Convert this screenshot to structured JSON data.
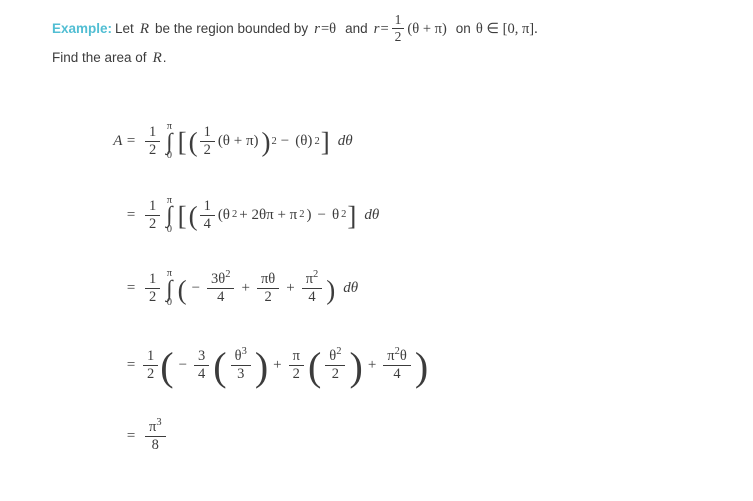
{
  "colors": {
    "accent": "#51bed3",
    "text": "#3c3c3c",
    "background": "#ffffff"
  },
  "prose": {
    "example_label": "Example:",
    "statement_pre": "Let",
    "statement_var_R": "R",
    "statement_mid1": "be the region bounded by",
    "eq1_var_r": "r",
    "eq1_equals": "=",
    "eq1_theta": "θ",
    "statement_and": "and",
    "eq2_var_r": "r",
    "eq2_equals": "=",
    "eq2_frac_num": "1",
    "eq2_frac_den": "2",
    "eq2_group": "(θ + π)",
    "statement_on": "on",
    "domain": "θ ∈ [0, π].",
    "question_pre": "Find the area of",
    "question_var_R": "R",
    "question_period": "."
  },
  "derivation": {
    "lines": [
      {
        "id": "line-1",
        "lhs": "A  =",
        "outer_frac_num": "1",
        "outer_frac_den": "2",
        "integral_upper": "π",
        "integral_lower": "0",
        "integral_symbol": "∫",
        "bracket_open": "[",
        "paren_open": "(",
        "inner_frac_num": "1",
        "inner_frac_den": "2",
        "inner_group": "(θ + π)",
        "paren_close": ")",
        "exp_outer": "2",
        "minus": "−",
        "term2": "(θ)",
        "term2_exp": "2",
        "bracket_close": "]",
        "differential": "dθ"
      },
      {
        "id": "line-2",
        "lhs": "=",
        "outer_frac_num": "1",
        "outer_frac_den": "2",
        "integral_upper": "π",
        "integral_lower": "0",
        "integral_symbol": "∫",
        "bracket_open": "[",
        "paren_open": "(",
        "inner_frac_num": "1",
        "inner_frac_den": "4",
        "expansion": "(θ",
        "expansion_exp1": "2",
        "expansion_mid": "+ 2θπ + π",
        "expansion_exp2": "2",
        "expansion_close": ")",
        "minus": "−",
        "term2": "θ",
        "term2_exp": "2",
        "bracket_close": "]",
        "differential": "dθ"
      },
      {
        "id": "line-3",
        "lhs": "=",
        "outer_frac_num": "1",
        "outer_frac_den": "2",
        "integral_upper": "π",
        "integral_lower": "0",
        "integral_symbol": "∫",
        "paren_open": "(",
        "minus": "−",
        "t1_num": "3θ",
        "t1_num_exp": "2",
        "t1_den": "4",
        "plus1": "+",
        "t2_num": "πθ",
        "t2_den": "2",
        "plus2": "+",
        "t3_num": "π",
        "t3_num_exp": "2",
        "t3_den": "4",
        "paren_close": ")",
        "differential": "dθ"
      },
      {
        "id": "line-4",
        "lhs": "=",
        "outer_frac_num": "1",
        "outer_frac_den": "2",
        "paren_open": "(",
        "minus": "−",
        "c1_num": "3",
        "c1_den": "4",
        "g1_num": "θ",
        "g1_num_exp": "3",
        "g1_den": "3",
        "plus1": "+",
        "c2_num": "π",
        "c2_den": "2",
        "g2_num": "θ",
        "g2_num_exp": "2",
        "g2_den": "2",
        "plus2": "+",
        "t3_num": "π",
        "t3_num_exp": "2",
        "t3_num_theta": "θ",
        "t3_den": "4",
        "paren_close": ")"
      },
      {
        "id": "line-5",
        "lhs": "=",
        "result_num": "π",
        "result_num_exp": "3",
        "result_den": "8"
      }
    ]
  }
}
